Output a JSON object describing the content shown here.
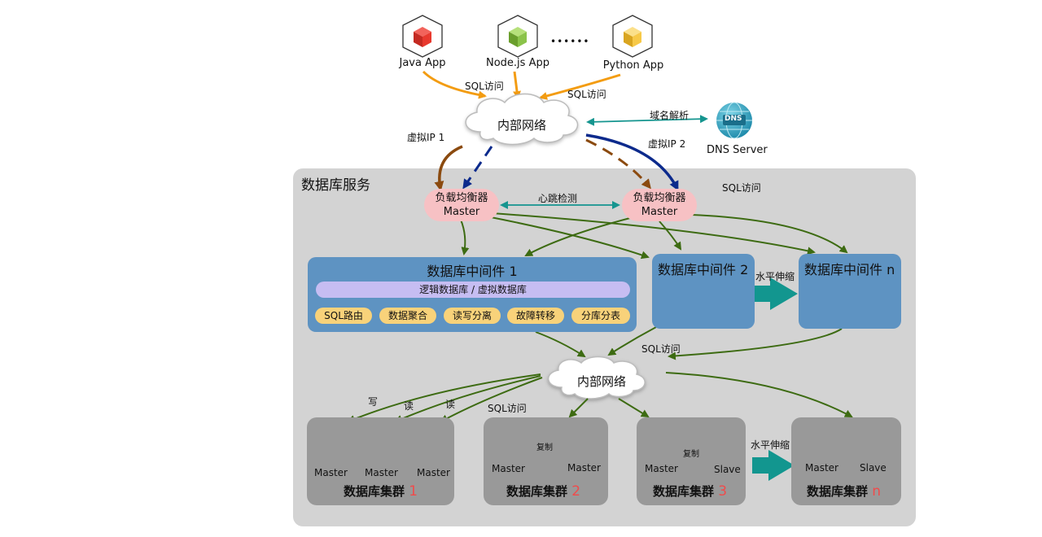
{
  "apps": [
    {
      "label": "Java App",
      "color": "#e8392e"
    },
    {
      "label": "Node.js App",
      "color": "#8bc34a"
    },
    {
      "label": "Python App",
      "color": "#f7c948"
    }
  ],
  "apps_ellipsis": "••••••",
  "sql_access": "SQL访问",
  "network_label": "内部网络",
  "dns": {
    "label": "DNS Server",
    "icon_text": "DNS",
    "resolve_label": "域名解析"
  },
  "vip1": "虚拟IP 1",
  "vip2": "虚拟IP 2",
  "service_title": "数据库服务",
  "lb": {
    "line1": "负载均衡器",
    "line2": "Master",
    "heartbeat": "心跳检测"
  },
  "middleware": {
    "main_title": "数据库中间件 1",
    "logic_bar": "逻辑数据库 / 虚拟数据库",
    "features": [
      "SQL路由",
      "数据聚合",
      "读写分离",
      "故障转移",
      "分库分表"
    ],
    "mw2_title": "数据库中间件 2",
    "mwn_title": "数据库中间件 n",
    "scale_label": "水平伸缩"
  },
  "rw": {
    "write": "写",
    "read1": "读",
    "read2": "读"
  },
  "clusters": [
    {
      "name": "数据库集群",
      "num": "1",
      "nodes": [
        "Master",
        "Master",
        "Master"
      ]
    },
    {
      "name": "数据库集群",
      "num": "2",
      "nodes": [
        "Master",
        "Master"
      ],
      "replicate": "复制"
    },
    {
      "name": "数据库集群",
      "num": "3",
      "nodes": [
        "Master",
        "Slave"
      ],
      "replicate": "复制"
    },
    {
      "name": "数据库集群",
      "num": "n",
      "nodes": [
        "Master",
        "Slave"
      ]
    }
  ],
  "cluster_scale_label": "水平伸缩",
  "colors": {
    "orange": "#f39c12",
    "brown": "#8b4a0f",
    "navy": "#0c2a8c",
    "teal": "#15958f",
    "green": "#3d6b12",
    "panel": "#d3d3d3",
    "middleware": "#5e93c2",
    "cluster": "#999999",
    "lb": "#f7c1c4"
  }
}
